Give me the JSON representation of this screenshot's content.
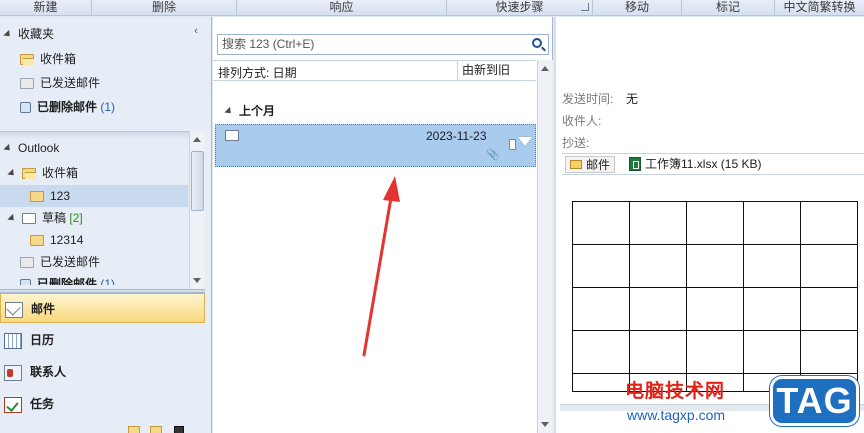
{
  "ribbon": {
    "groups": [
      "新建",
      "删除",
      "响应",
      "快速步骤",
      "移动",
      "标记",
      "中文简繁转换"
    ]
  },
  "nav": {
    "favorites": {
      "title": "收藏夹",
      "items": [
        {
          "label": "收件箱",
          "count": ""
        },
        {
          "label": "已发送邮件",
          "count": ""
        },
        {
          "label": "已删除邮件",
          "count": "(1)"
        }
      ]
    },
    "account": {
      "title": "Outlook",
      "inbox": "收件箱",
      "inbox_sub": "123",
      "drafts": "草稿",
      "drafts_count": "[2]",
      "drafts_sub": "12314",
      "sent": "已发送邮件",
      "deleted": "已删除邮件",
      "deleted_count": "(1)"
    },
    "buttons": [
      "邮件",
      "日历",
      "联系人",
      "任务"
    ]
  },
  "list": {
    "search_placeholder": "搜索 123 (Ctrl+E)",
    "sort_label": "排列方式: 日期",
    "sort_order": "由新到旧",
    "group_header": "上个月",
    "message": {
      "date": "2023-11-23",
      "attachment_icon": "paperclip-icon"
    }
  },
  "reading": {
    "sent_label": "发送时间:",
    "sent_value": "无",
    "to_label": "收件人:",
    "cc_label": "抄送:",
    "mail_tab": "邮件",
    "attachment": "工作簿11.xlsx (15 KB)"
  },
  "watermark": {
    "cn": "电脑技术网",
    "url": "www.tagxp.com",
    "tag": "TAG"
  },
  "colors": {
    "selected_row": "#a9cbee",
    "active_nav": "#f9d97e",
    "arrow": "#e3342f",
    "watermark_red": "#e2231a",
    "watermark_blue": "#1f6fc0"
  }
}
